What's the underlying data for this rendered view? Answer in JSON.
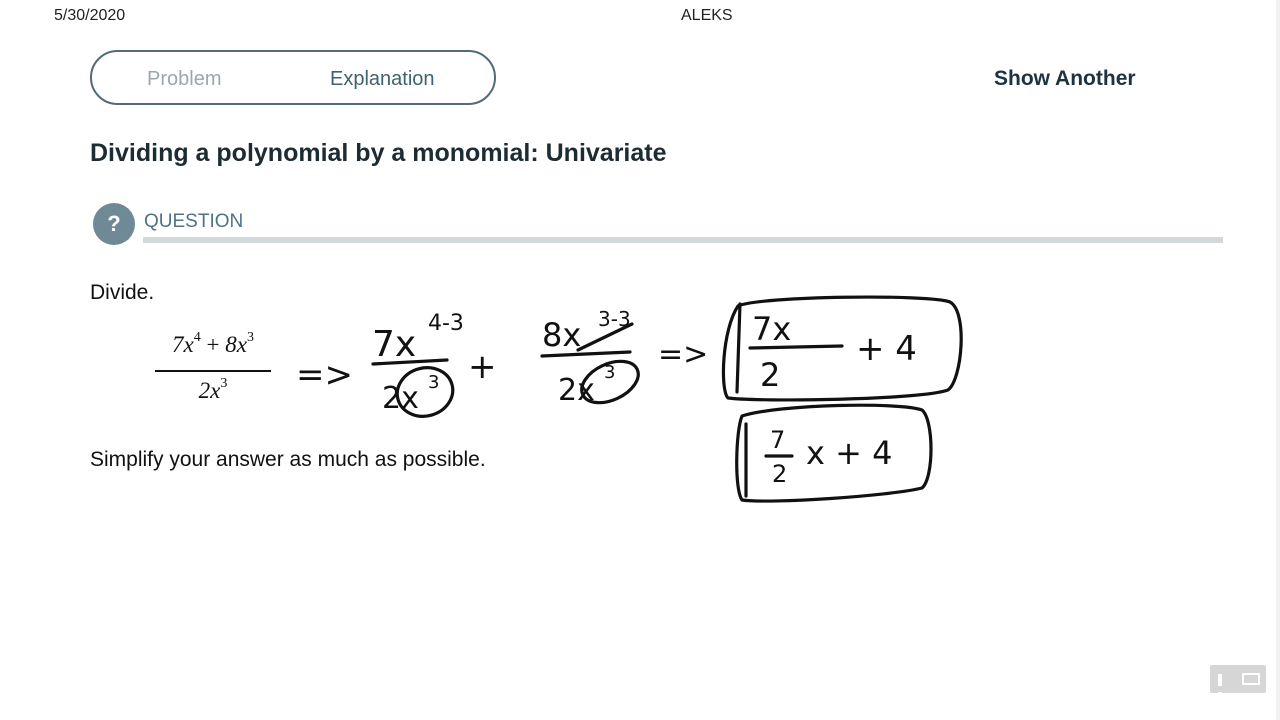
{
  "header": {
    "date": "5/30/2020",
    "app_title": "ALEKS"
  },
  "tabs": [
    {
      "label": "Problem",
      "active": false
    },
    {
      "label": "Explanation",
      "active": true
    }
  ],
  "actions": {
    "show_another": "Show Another"
  },
  "page": {
    "title": "Dividing a polynomial by a monomial: Univariate"
  },
  "question": {
    "icon": "question-mark-icon",
    "icon_glyph": "?",
    "label": "QUESTION",
    "prompt": "Divide.",
    "instruction": "Simplify your answer as much as possible."
  },
  "expression": {
    "numerator": {
      "term1_coef": "7x",
      "term1_exp": "4",
      "plus": "+",
      "term2_coef": "8x",
      "term2_exp": "3"
    },
    "denominator": {
      "coef": "2x",
      "exp": "3"
    }
  },
  "handwriting": {
    "arrow1": "=>",
    "step1_num": "7x",
    "step1_exp": "4-3",
    "step1_den": "2x",
    "step1_den_exp": "3",
    "plus": "+",
    "step2_num": "8x",
    "step2_exp": "3-3",
    "step2_den": "2x",
    "step2_den_exp": "3",
    "arrow2": "=>",
    "answer1_num": "7x",
    "answer1_den": "2",
    "answer1_rest": "+ 4",
    "answer2_num": "7",
    "answer2_den": "2",
    "answer2_rest": "x + 4"
  },
  "colors": {
    "accent": "#4f6c78",
    "title": "#1d2b33",
    "question_label": "#4e7385"
  }
}
